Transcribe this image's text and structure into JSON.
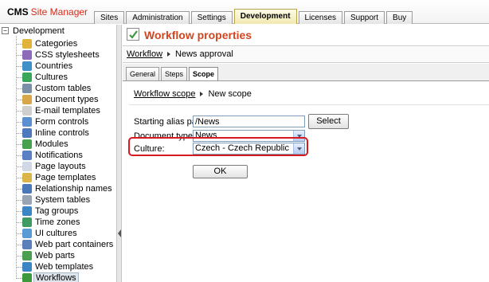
{
  "header": {
    "logo_cms": "CMS",
    "logo_product": "Site Manager",
    "tabs": [
      {
        "label": "Sites",
        "active": false
      },
      {
        "label": "Administration",
        "active": false
      },
      {
        "label": "Settings",
        "active": false
      },
      {
        "label": "Development",
        "active": true
      },
      {
        "label": "Licenses",
        "active": false
      },
      {
        "label": "Support",
        "active": false
      },
      {
        "label": "Buy",
        "active": false
      }
    ]
  },
  "tree": {
    "root_label": "Development",
    "collapse_glyph": "−",
    "items": [
      {
        "label": "Categories",
        "icon": "categories-icon",
        "color": "#e0b33a"
      },
      {
        "label": "CSS stylesheets",
        "icon": "css-stylesheets-icon",
        "color": "#8c6bb8"
      },
      {
        "label": "Countries",
        "icon": "globe-icon",
        "color": "#3f8fc9"
      },
      {
        "label": "Cultures",
        "icon": "globe-flag-icon",
        "color": "#3aa65a"
      },
      {
        "label": "Custom tables",
        "icon": "table-icon",
        "color": "#7b8fa6"
      },
      {
        "label": "Document types",
        "icon": "document-types-icon",
        "color": "#d8a74a"
      },
      {
        "label": "E-mail templates",
        "icon": "email-icon",
        "color": "#cfcfcf"
      },
      {
        "label": "Form controls",
        "icon": "form-controls-icon",
        "color": "#5b8fd0"
      },
      {
        "label": "Inline controls",
        "icon": "inline-controls-icon",
        "color": "#4f79bd"
      },
      {
        "label": "Modules",
        "icon": "modules-icon",
        "color": "#48a14f"
      },
      {
        "label": "Notifications",
        "icon": "notifications-icon",
        "color": "#5a7fc2"
      },
      {
        "label": "Page layouts",
        "icon": "page-layouts-icon",
        "color": "#cfd8e4"
      },
      {
        "label": "Page templates",
        "icon": "page-templates-icon",
        "color": "#d9b54a"
      },
      {
        "label": "Relationship names",
        "icon": "relationship-icon",
        "color": "#4b79b8"
      },
      {
        "label": "System tables",
        "icon": "system-tables-icon",
        "color": "#9aa5b3"
      },
      {
        "label": "Tag groups",
        "icon": "tag-groups-icon",
        "color": "#3d86c6"
      },
      {
        "label": "Time zones",
        "icon": "clock-icon",
        "color": "#3f9b62"
      },
      {
        "label": "UI cultures",
        "icon": "ui-cultures-icon",
        "color": "#5b9bd5"
      },
      {
        "label": "Web part containers",
        "icon": "web-part-containers-icon",
        "color": "#5b7fb8"
      },
      {
        "label": "Web parts",
        "icon": "web-parts-icon",
        "color": "#4aa04f"
      },
      {
        "label": "Web templates",
        "icon": "web-templates-icon",
        "color": "#3c86c4"
      },
      {
        "label": "Workflows",
        "icon": "workflow-check-icon",
        "color": "#3c9a3c",
        "selected": true
      }
    ]
  },
  "content": {
    "title": "Workflow properties",
    "breadcrumb": {
      "link": "Workflow",
      "current": "News approval"
    },
    "subtabs": [
      {
        "label": "General",
        "active": false
      },
      {
        "label": "Steps",
        "active": false
      },
      {
        "label": "Scope",
        "active": true
      }
    ],
    "scope_breadcrumb": {
      "link": "Workflow scope",
      "current": "New scope"
    },
    "form": {
      "alias_label": "Starting alias path:",
      "alias_value": "/News",
      "select_button": "Select",
      "doctype_label": "Document type:",
      "doctype_value": "News",
      "culture_label": "Culture:",
      "culture_value": "Czech - Czech Republic",
      "ok_button": "OK"
    },
    "highlight_color": "#d71920"
  }
}
